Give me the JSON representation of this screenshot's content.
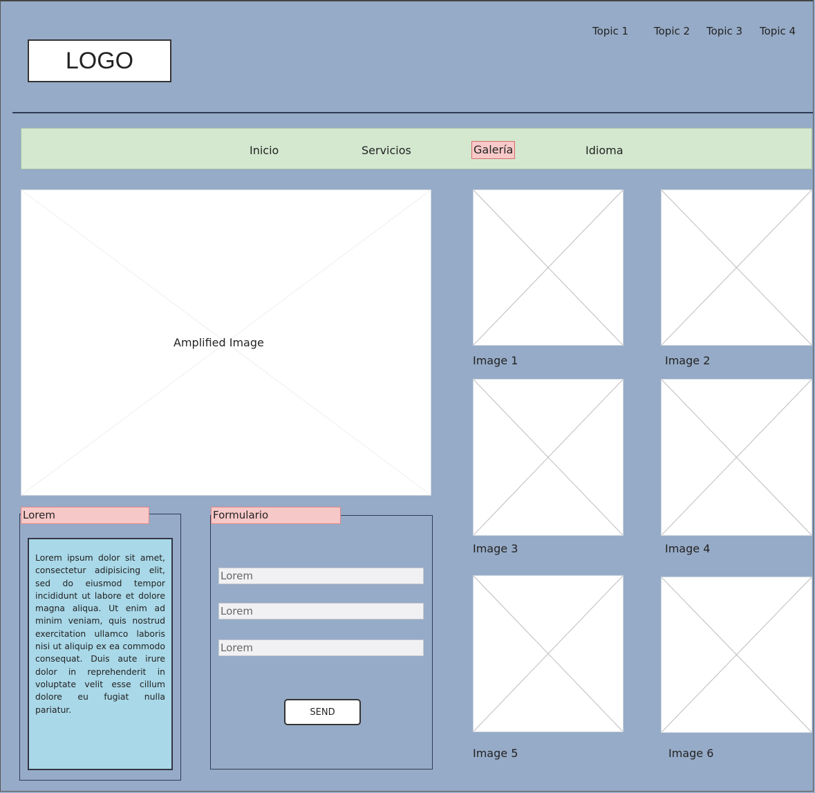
{
  "header": {
    "logo_text": "LOGO",
    "topics": [
      "Topic 1",
      "Topic 2",
      "Topic 3",
      "Topic 4"
    ]
  },
  "nav": {
    "items": [
      "Inicio",
      "Servicios",
      "Galería",
      "Idioma"
    ],
    "active": "Galería"
  },
  "main": {
    "amplified_caption": "Amplified Image"
  },
  "gallery": {
    "captions": [
      "Image 1",
      "Image 2",
      "Image 3",
      "Image 4",
      "Image 5",
      "Image 6"
    ]
  },
  "lorem_panel": {
    "title": "Lorem",
    "text": "Lorem ipsum dolor sit amet, consectetur adipisicing elit, sed do eiusmod tempor incididunt ut labore et dolore magna aliqua. Ut enim ad minim veniam, quis nostrud exercitation ullamco laboris nisi ut aliquip ex ea commodo consequat. Duis aute irure dolor in reprehenderit in voluptate velit esse cillum dolore eu fugiat nulla pariatur."
  },
  "form_panel": {
    "title": "Formulario",
    "fields": [
      "Lorem",
      "Lorem",
      "Lorem"
    ],
    "send_label": "SEND"
  }
}
